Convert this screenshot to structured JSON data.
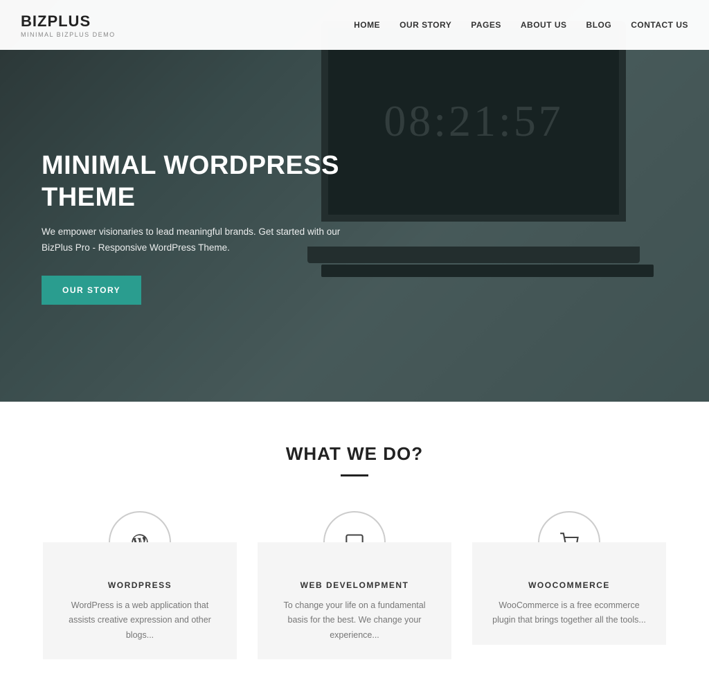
{
  "header": {
    "logo_title": "BIZPLUS",
    "logo_sub": "MINIMAL BIZPLUS DEMO",
    "nav_items": [
      {
        "label": "HOME",
        "href": "#"
      },
      {
        "label": "OUR STORY",
        "href": "#"
      },
      {
        "label": "PAGES",
        "href": "#"
      },
      {
        "label": "ABOUT US",
        "href": "#"
      },
      {
        "label": "BLOG",
        "href": "#"
      },
      {
        "label": "CONTACT US",
        "href": "#"
      }
    ]
  },
  "hero": {
    "title": "MINIMAL WORDPRESS THEME",
    "description": "We empower visionaries to lead meaningful brands. Get started with our BizPlus Pro - Responsive WordPress Theme.",
    "cta_label": "OUR STORY",
    "clock": "08:21:57"
  },
  "what_section": {
    "title": "WHAT WE DO?",
    "services": [
      {
        "icon": "W",
        "name": "WORDPRESS",
        "description": "WordPress is a web application that assists creative expression and other blogs...",
        "icon_type": "wordpress"
      },
      {
        "icon": "🖥",
        "name": "WEB DEVELOMPMENT",
        "description": "To change your life on a fundamental basis for the best. We change your experience...",
        "icon_type": "monitor"
      },
      {
        "icon": "🛒",
        "name": "WOOCOMMERCE",
        "description": "WooCommerce is a free ecommerce plugin that brings together all the tools...",
        "icon_type": "cart"
      }
    ]
  }
}
